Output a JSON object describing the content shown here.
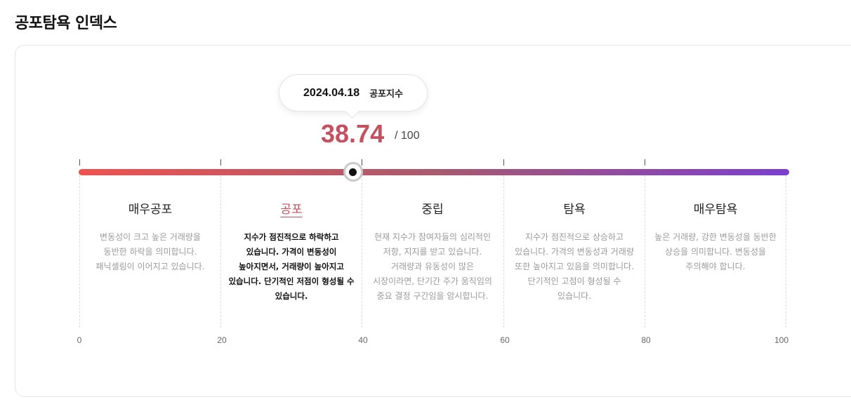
{
  "page_title": "공포탐욕 인덱스",
  "tooltip": {
    "date": "2024.04.18",
    "label": "공포지수"
  },
  "score": {
    "value": "38.74",
    "max_text": "/ 100",
    "value_numeric": 38.74,
    "max_numeric": 100
  },
  "colors": {
    "gradient_start": "#ef5350",
    "gradient_mid": "#a85a6e",
    "gradient_end": "#7b3fce",
    "active": "#c4515f"
  },
  "zones": [
    {
      "title": "매우공포",
      "description": "변동성이 크고 높은 거래량을 동반한 하락을 의미합니다. 패닉셀링이 이어지고 있습니다.",
      "active": false
    },
    {
      "title": "공포",
      "description": "지수가 점진적으로 하락하고 있습니다. 가격이 변동성이 높아지면서, 거래량이 높아지고 있습니다. 단기적인 저점이 형성될 수 있습니다.",
      "active": true
    },
    {
      "title": "중립",
      "description": "현재 지수가 참여자들의 심리적인 저항, 지지를 받고 있습니다. 거래량과 유동성이 많은 시장이라면, 단기간 주가 움직임의 중요 결정 구간임을 암시합니다.",
      "active": false
    },
    {
      "title": "탐욕",
      "description": "지수가 점진적으로 상승하고 있습니다. 가격의 변동성과 거래량 또한 높아지고 있음을 의미합니다. 단기적인 고점이 형성될 수 있습니다.",
      "active": false
    },
    {
      "title": "매우탐욕",
      "description": "높은 거래량, 강한 변동성을 동반한 상승을 의미합니다. 변동성을 주의해야 합니다.",
      "active": false
    }
  ],
  "axis_labels": [
    "0",
    "20",
    "40",
    "60",
    "80",
    "100"
  ]
}
